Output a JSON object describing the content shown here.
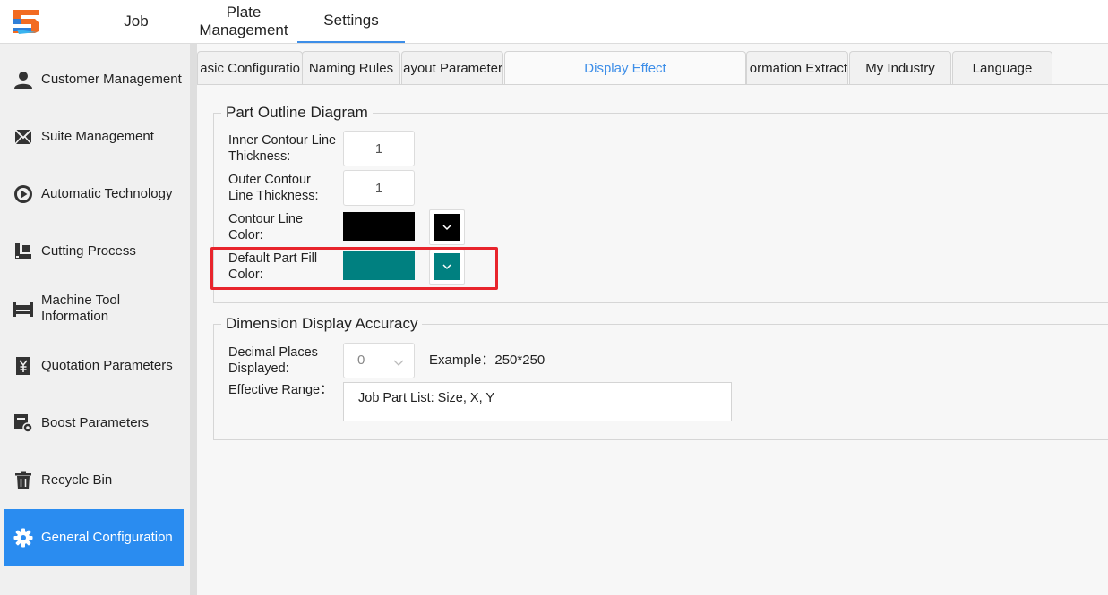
{
  "colors": {
    "accent": "#2a8cf0",
    "highlight": "#e8242c",
    "contour_color": "#000000",
    "fill_color": "#008080"
  },
  "top_tabs": [
    {
      "label": "Job"
    },
    {
      "label": "Plate\nManagement"
    },
    {
      "label": "Settings",
      "active": true
    }
  ],
  "sidebar": {
    "items": [
      {
        "label": "Customer Management",
        "icon": "person-icon"
      },
      {
        "label": "Suite Management",
        "icon": "envelope-icon"
      },
      {
        "label": "Automatic Technology",
        "icon": "play-circle-icon"
      },
      {
        "label": "Cutting Process",
        "icon": "cutting-machine-icon"
      },
      {
        "label": "Machine Tool\nInformation",
        "icon": "machine-bed-icon"
      },
      {
        "label": "Quotation Parameters",
        "icon": "yuan-list-icon"
      },
      {
        "label": "Boost Parameters",
        "icon": "settings-board-icon"
      },
      {
        "label": "Recycle Bin",
        "icon": "trash-icon"
      },
      {
        "label": "General Configuration",
        "icon": "gear-icon",
        "active": true
      }
    ]
  },
  "subtabs": [
    {
      "label": "asic Configuratio"
    },
    {
      "label": "Naming Rules"
    },
    {
      "label": "ayout Parameter"
    },
    {
      "label": "Display Effect",
      "active": true
    },
    {
      "label": "ormation Extract"
    },
    {
      "label": "My Industry"
    },
    {
      "label": "Language"
    }
  ],
  "part_outline": {
    "title": "Part Outline Diagram",
    "inner_label": "Inner Contour Line\nThickness:",
    "inner_value": "1",
    "outer_label": "Outer Contour\nLine Thickness:",
    "outer_value": "1",
    "contour_color_label": "Contour Line\nColor:",
    "fill_color_label": "Default Part Fill\nColor:"
  },
  "dimension": {
    "title": "Dimension Display Accuracy",
    "decimal_label": "Decimal Places\nDisplayed:",
    "decimal_value": "0",
    "example": "Example：250*250",
    "range_label": "Effective Range：",
    "range_value": "Job Part List: Size, X, Y"
  }
}
